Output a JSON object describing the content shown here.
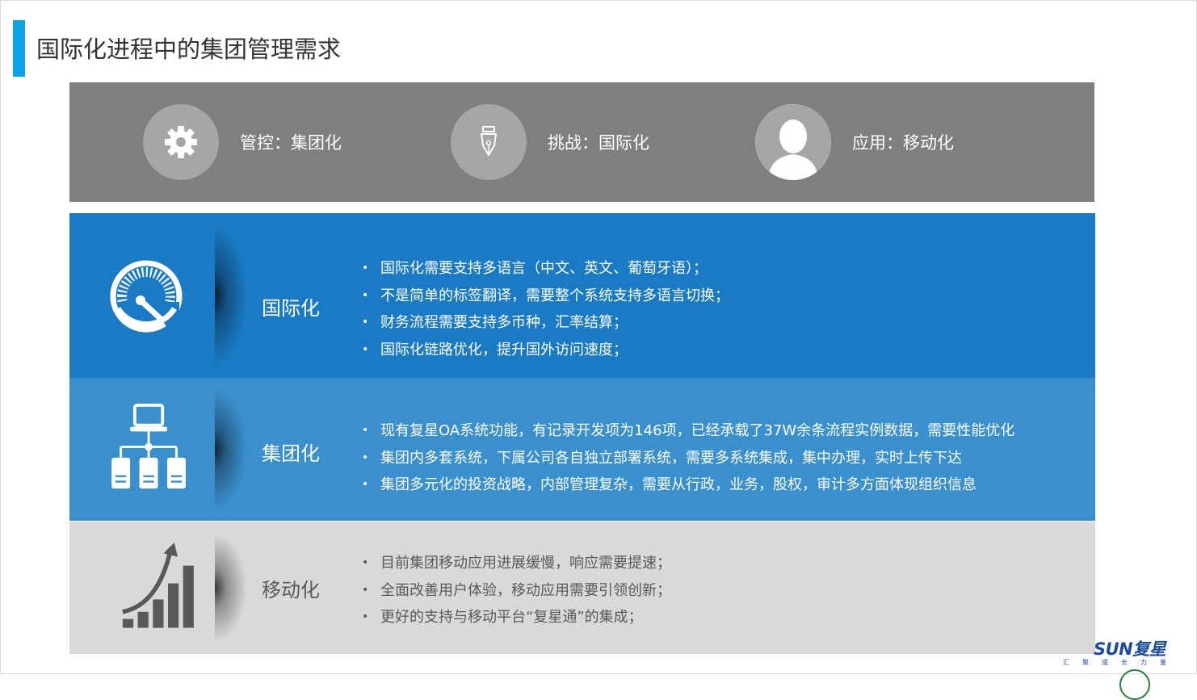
{
  "page": {
    "title": "国际化进程中的集团管理需求"
  },
  "header_band": {
    "items": [
      {
        "label": "管控：集团化",
        "icon": "gear-icon"
      },
      {
        "label": "挑战：国际化",
        "icon": "pen-nib-icon"
      },
      {
        "label": "应用：移动化",
        "icon": "user-silhouette-icon"
      }
    ]
  },
  "sections": [
    {
      "title": "国际化",
      "icon": "speedometer-icon",
      "bullets": [
        "国际化需要支持多语言（中文、英文、葡萄牙语）；",
        "不是简单的标签翻译，需要整个系统支持多语言切换；",
        "财务流程需要支持多币种，汇率结算；",
        "国际化链路优化，提升国外访问速度；"
      ]
    },
    {
      "title": "集团化",
      "icon": "network-servers-icon",
      "bullets": [
        "现有复星OA系统功能，有记录开发项为146项，已经承载了37W余条流程实例数据，需要性能优化",
        "集团内多套系统，下属公司各自独立部署系统，需要多系统集成，集中办理，实时上传下达",
        "集团多元化的投资战略，内部管理复杂，需要从行政，业务，股权，审计多方面体现组织信息"
      ]
    },
    {
      "title": "移动化",
      "icon": "growth-chart-icon",
      "bullets": [
        "目前集团移动应用进展缓慢，响应需要提速；",
        "全面改善用户体验，移动应用需要引领创新；",
        "更好的支持与移动平台“复星通”的集成；"
      ]
    }
  ],
  "logo": {
    "text": "SUN复星",
    "tagline": "汇聚成长力量"
  },
  "colors": {
    "accent": "#0aa3e8",
    "band": "#7f7f7f",
    "row1": "#1a7ac4",
    "row2": "#3a8fcd",
    "row3": "#d9d9d9"
  }
}
